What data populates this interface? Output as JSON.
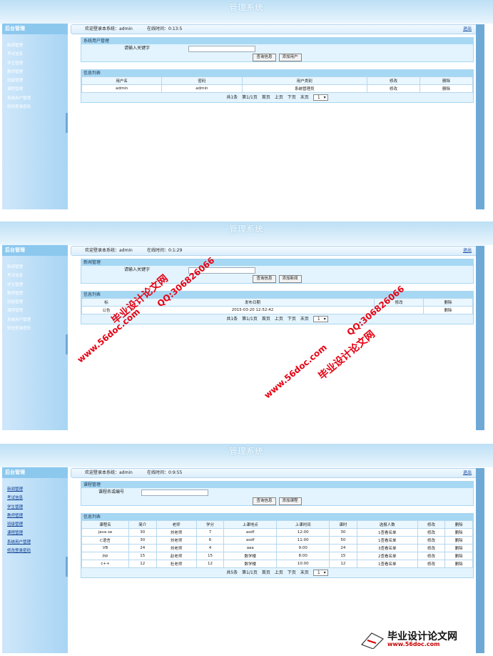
{
  "app_title": "管理系统",
  "sidebar": {
    "header": "后台管理",
    "items": [
      "新闻管理",
      "考试信息",
      "学生管理",
      "教师管理",
      "班级管理",
      "课程管理",
      "系统用户管理",
      "修改登录密码"
    ]
  },
  "header": {
    "welcome": "欢迎登录本系统：admin",
    "logout": "退出"
  },
  "screens": [
    {
      "online_time": "在线时间：0:13:5",
      "section_title": "系统用户管理",
      "search_label": "请输入关键字",
      "search_value": "",
      "query_button": "查询信息",
      "add_button": "添加用户",
      "list_title": "信息列表",
      "columns": [
        "用户名",
        "密码",
        "用户类别",
        "修改",
        "删除"
      ],
      "rows": [
        [
          "admin",
          "admin",
          "系统管理员",
          "修改",
          "删除"
        ]
      ]
    },
    {
      "online_time": "在线时间：0:1:29",
      "section_title": "新闻管理",
      "search_label": "请输入关键字",
      "search_value": "",
      "query_button": "查询信息",
      "add_button": "添加新闻",
      "list_title": "信息列表",
      "columns": [
        "标",
        "发布日期",
        "修改",
        "删除"
      ],
      "rows": [
        [
          "公告",
          "2015-03-20 12:52:42",
          "",
          "删除"
        ]
      ]
    },
    {
      "online_time": "在线时间：0:9:55",
      "section_title": "课程管理",
      "search_label": "课程名或编号",
      "search_value": "",
      "query_button": "查询信息",
      "add_button": "添加课程",
      "list_title": "信息列表",
      "columns": [
        "课程名",
        "简介",
        "老师",
        "学分",
        "上课地点",
        "上课时间",
        "课时",
        "选报人数",
        "修改",
        "删除"
      ],
      "rows": [
        [
          "java se",
          "30",
          "刘老师",
          "7",
          "asdf",
          "12:00",
          "30",
          "1查看名单",
          "修改",
          "删除"
        ],
        [
          "C语言",
          "30",
          "刘老师",
          "6",
          "asdf",
          "11:00",
          "50",
          "1查看名单",
          "修改",
          "删除"
        ],
        [
          "VB",
          "24",
          "刘老师",
          "4",
          "aaa",
          "9:00",
          "24",
          "3查看名单",
          "修改",
          "删除"
        ],
        [
          "jsp",
          "15",
          "赵老师",
          "15",
          "数学楼",
          "8:00",
          "15",
          "2查看名单",
          "修改",
          "删除"
        ],
        [
          "c++",
          "12",
          "杜老师",
          "12",
          "数学楼",
          "10:00",
          "12",
          "1查看名单",
          "修改",
          "删除"
        ]
      ]
    }
  ],
  "pager": {
    "total": "共5条",
    "page": "第1/1页",
    "first": "首页",
    "prev": "上页",
    "next": "下页",
    "last": "末页",
    "select": "1"
  },
  "pager_first": {
    "total": "共1条",
    "page": "第1/1页",
    "first": "首页",
    "prev": "上页",
    "next": "下页",
    "last": "末页",
    "select": "1"
  },
  "watermarks": {
    "qq": "QQ:306826066",
    "site": "www.56doc.com",
    "brand": "毕业设计论文网"
  },
  "logo": {
    "title": "毕业设计论文网",
    "url": "www.56doc.com"
  },
  "colors": {
    "watermark": "#e60012",
    "sidebar": "#a9d5f4",
    "section_caption": "#a6d8f4"
  }
}
